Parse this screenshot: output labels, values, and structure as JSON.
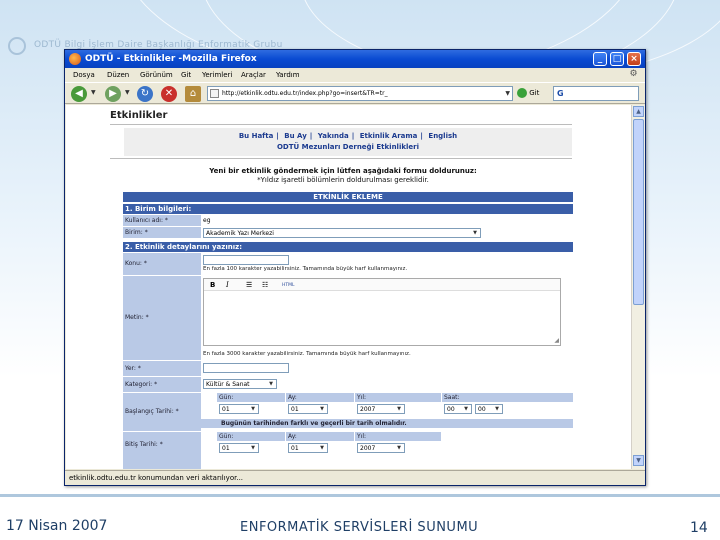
{
  "slide": {
    "header": "ODTÜ Bilgi İşlem Daire Başkanlığı Enformatik Grubu",
    "footer_date": "17 Nisan 2007",
    "footer_title": "ENFORMATİK SERVİSLERİ SUNUMU",
    "footer_page": "14"
  },
  "browser": {
    "title": "ODTÜ - Etkinlikler -Mozilla Firefox",
    "menu": [
      "Dosya",
      "Düzen",
      "Görünüm",
      "Git",
      "Yerimleri",
      "Araçlar",
      "Yardım"
    ],
    "url": "http://etkinlik.odtu.edu.tr/index.php?go=insert&TR=tr_",
    "go_label": "Git",
    "search_value": "G",
    "status": "etkinlik.odtu.edu.tr konumundan veri aktarılıyor..."
  },
  "page": {
    "title": "Etkinlikler",
    "nav_links": [
      "Bu Hafta",
      "Bu Ay",
      "Yakında",
      "Etkinlik Arama",
      "English"
    ],
    "nav_sub": "ODTÜ Mezunları Derneği Etkinlikleri",
    "intro_bold": "Yeni bir etkinlik göndermek için lütfen aşağıdaki formu doldurunuz:",
    "intro_note": "*Yıldız işaretli bölümlerin doldurulması gereklidir.",
    "form_title": "ETKİNLİK EKLEME",
    "section1": "1. Birim bilgileri:",
    "kullanici_label": "Kullanıcı adı: *",
    "kullanici_value": "eg",
    "birim_label": "Birim: *",
    "birim_value": "Akademik Yazı Merkezi",
    "section2": "2. Etkinlik detaylarını yazınız:",
    "konu_label": "Konu: *",
    "konu_note": "En fazla 100 karakter yazabilirsiniz. Tamamında büyük harf kullanmayınız.",
    "metin_label": "Metin: *",
    "editor_bold": "B",
    "editor_italic": "I",
    "editor_html": "HTML",
    "metin_note": "En fazla 3000 karakter yazabilirsiniz. Tamamında büyük harf kullanmayınız.",
    "yer_label": "Yer: *",
    "kategori_label": "Kategori: *",
    "kategori_value": "Kültür & Sanat",
    "baslangic_label": "Başlangıç Tarihi: *",
    "bitis_label": "Bitiş Tarihi: *",
    "dt_headers": [
      "Gün:",
      "Ay:",
      "Yıl:",
      "Saat:"
    ],
    "dt_headers_end": [
      "Gün:",
      "Ay:",
      "Yıl:"
    ],
    "start_gun": "01",
    "start_ay": "01",
    "start_yil": "2007",
    "start_saat": "00",
    "start_dakika": "00",
    "date_warning": "Bugünün tarihinden farklı ve geçerli bir tarih olmalıdır.",
    "end_gun": "01",
    "end_ay": "01",
    "end_yil": "2007"
  }
}
